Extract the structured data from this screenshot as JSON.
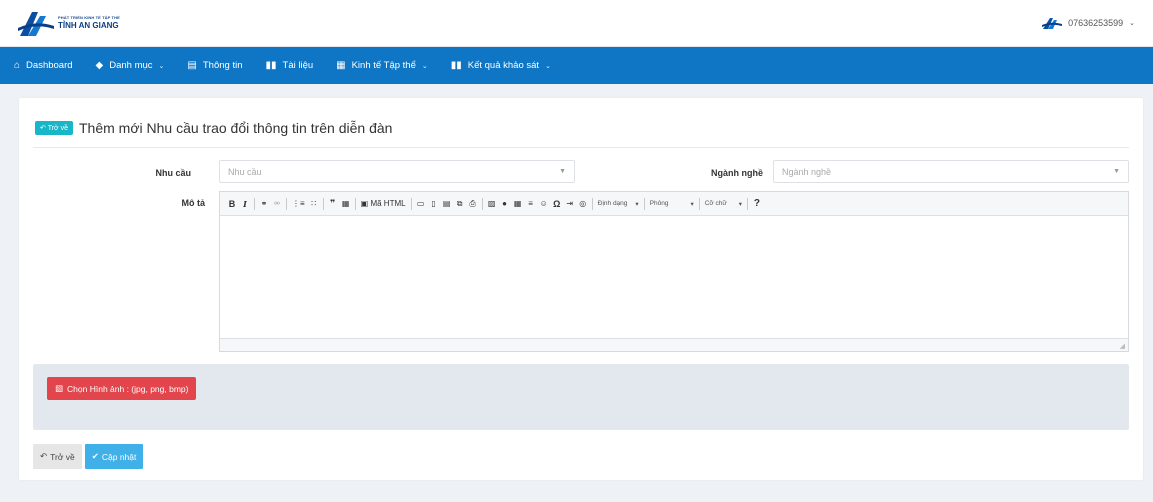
{
  "header": {
    "logo_line1": "PHÁT TRIỂN KINH TẾ TẬP THỂ",
    "logo_line2": "TỈNH AN GIANG",
    "user_phone": "07636253599"
  },
  "nav": {
    "items": [
      {
        "label": "Dashboard",
        "icon": "home-icon"
      },
      {
        "label": "Danh mục",
        "icon": "tag-icon",
        "dropdown": true
      },
      {
        "label": "Thông tin",
        "icon": "newspaper-icon"
      },
      {
        "label": "Tài liệu",
        "icon": "book-icon"
      },
      {
        "label": "Kinh tế Tập thể",
        "icon": "list-icon",
        "dropdown": true
      },
      {
        "label": "Kết quả khảo sát",
        "icon": "book-icon",
        "dropdown": true
      }
    ]
  },
  "page": {
    "back_small": "Trở về",
    "title": "Thêm mới Nhu cầu trao đổi thông tin trên diễn đàn"
  },
  "form": {
    "nhu_cau_label": "Nhu cầu",
    "nhu_cau_placeholder": "Nhu cầu",
    "nganh_nghe_label": "Ngành nghề",
    "nganh_nghe_placeholder": "Ngành nghề",
    "mo_ta_label": "Mô tả"
  },
  "editor": {
    "source_label": "Mã HTML",
    "format_label": "Định dạng",
    "font_label": "Phông",
    "size_label": "Cỡ chữ",
    "help_label": "?"
  },
  "upload": {
    "button_label": "Chọn Hình ảnh : (jpg, png, bmp)"
  },
  "actions": {
    "back_label": "Trở về",
    "save_label": "Cập nhật"
  },
  "colors": {
    "nav_bg": "#0f76c5",
    "accent_teal": "#17b6c9",
    "upload_red": "#e2454c",
    "save_blue": "#3fb0e8"
  }
}
